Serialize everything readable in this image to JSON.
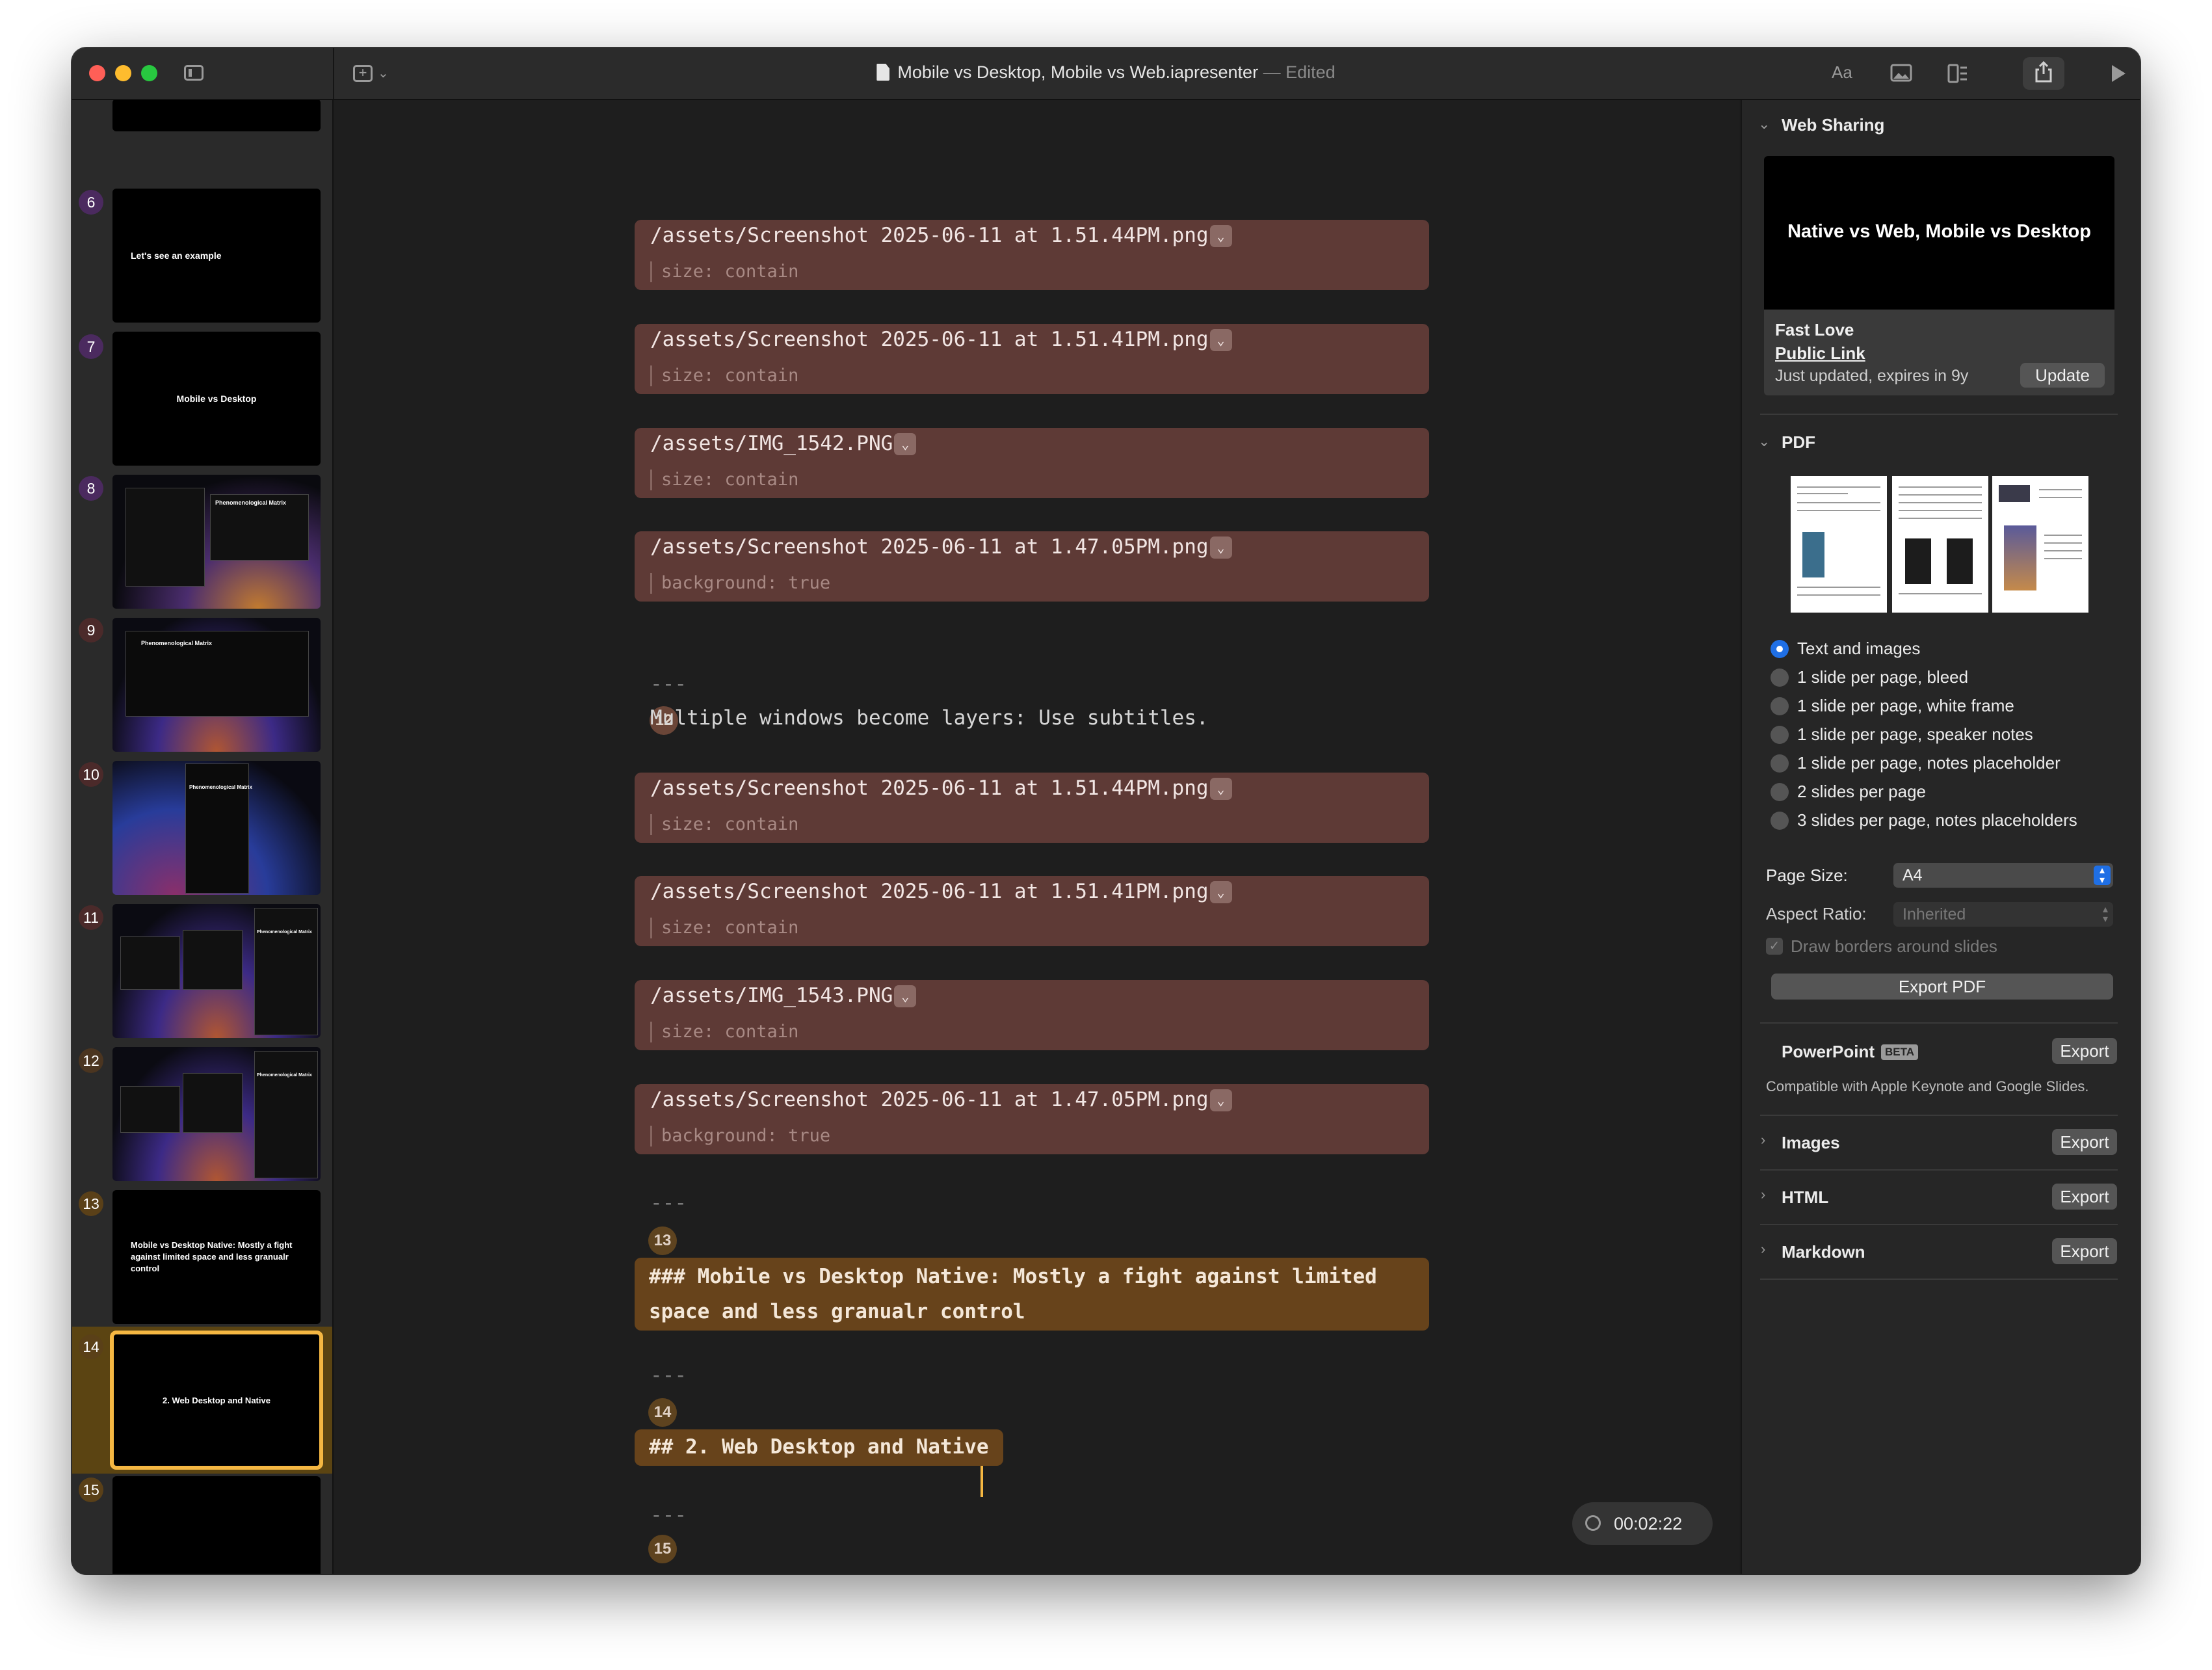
{
  "window": {
    "title": "Mobile vs Desktop, Mobile vs Web.iapresenter",
    "separator": "—",
    "status": "Edited",
    "toolbar": {
      "font_label": "Aa",
      "add_caret": "⌄"
    }
  },
  "sidebar": {
    "slides": [
      {
        "num": "6",
        "text": "Let's see an example"
      },
      {
        "num": "7",
        "text": "Mobile vs Desktop"
      },
      {
        "num": "8",
        "text": "Phenomenological Matrix"
      },
      {
        "num": "9",
        "text": "Phenomenological Matrix"
      },
      {
        "num": "10",
        "text": "Phenomenological Matrix"
      },
      {
        "num": "11",
        "text": "Phenomenological Matrix"
      },
      {
        "num": "12",
        "text": "Phenomenological Matrix"
      },
      {
        "num": "13",
        "text": "Mobile vs Desktop Native: Mostly a fight against limited space and less granualr control"
      },
      {
        "num": "14",
        "text": "2. Web Desktop and Native"
      },
      {
        "num": "15",
        "text": ""
      }
    ]
  },
  "editor": {
    "blocks": [
      {
        "path": "/assets/Screenshot 2025-06-11 at 1.51.44PM.png",
        "prop": "size: contain"
      },
      {
        "path": "/assets/Screenshot 2025-06-11 at 1.51.41PM.png",
        "prop": "size: contain"
      },
      {
        "path": "/assets/IMG_1542.PNG",
        "prop": "size: contain"
      },
      {
        "path": "/assets/Screenshot 2025-06-11 at 1.47.05PM.png",
        "prop": "background: true"
      },
      {
        "path": "/assets/Screenshot 2025-06-11 at 1.51.44PM.png",
        "prop": "size: contain"
      },
      {
        "path": "/assets/Screenshot 2025-06-11 at 1.51.41PM.png",
        "prop": "size: contain"
      },
      {
        "path": "/assets/IMG_1543.PNG",
        "prop": "size: contain"
      },
      {
        "path": "/assets/Screenshot 2025-06-11 at 1.47.05PM.png",
        "prop": "background: true"
      }
    ],
    "separator": "---",
    "slide12_text": "Multiple windows become layers: Use subtitles.",
    "heading13_line1": "### Mobile vs Desktop Native: Mostly a fight against limited",
    "heading13_line2": "space and less granualr control",
    "heading14": "## 2. Web Desktop and Native",
    "line_numbers": {
      "n12": "12",
      "n13": "13",
      "n14": "14",
      "n15": "15"
    },
    "timer": "00:02:22",
    "dropdown_glyph": "⌄"
  },
  "panel": {
    "web_sharing": {
      "heading": "Web Sharing",
      "preview_title": "Native vs Web, Mobile vs Desktop",
      "site_name": "Fast Love",
      "link_label": "Public Link",
      "status": "Just updated, expires in 9y",
      "update_button": "Update"
    },
    "pdf": {
      "heading": "PDF",
      "options": [
        "Text and images",
        "1 slide per page, bleed",
        "1 slide per page, white frame",
        "1 slide per page, speaker notes",
        "1 slide per page, notes placeholder",
        "2 slides per page",
        "3 slides per page, notes placeholders"
      ],
      "selected_index": 0,
      "page_size_label": "Page Size:",
      "page_size_value": "A4",
      "aspect_ratio_label": "Aspect Ratio:",
      "aspect_ratio_value": "Inherited",
      "draw_borders_label": "Draw borders around slides",
      "export_button": "Export PDF"
    },
    "powerpoint": {
      "heading": "PowerPoint",
      "badge": "BETA",
      "export": "Export",
      "note": "Compatible with Apple Keynote and Google Slides."
    },
    "images": {
      "heading": "Images",
      "export": "Export"
    },
    "html": {
      "heading": "HTML",
      "export": "Export"
    },
    "markdown": {
      "heading": "Markdown",
      "export": "Export"
    }
  },
  "colors": {
    "accent_selected": "#f5b742",
    "image_block": "#5e3a36",
    "heading_block": "#67431b",
    "radio_selected": "#1f6fe5"
  }
}
